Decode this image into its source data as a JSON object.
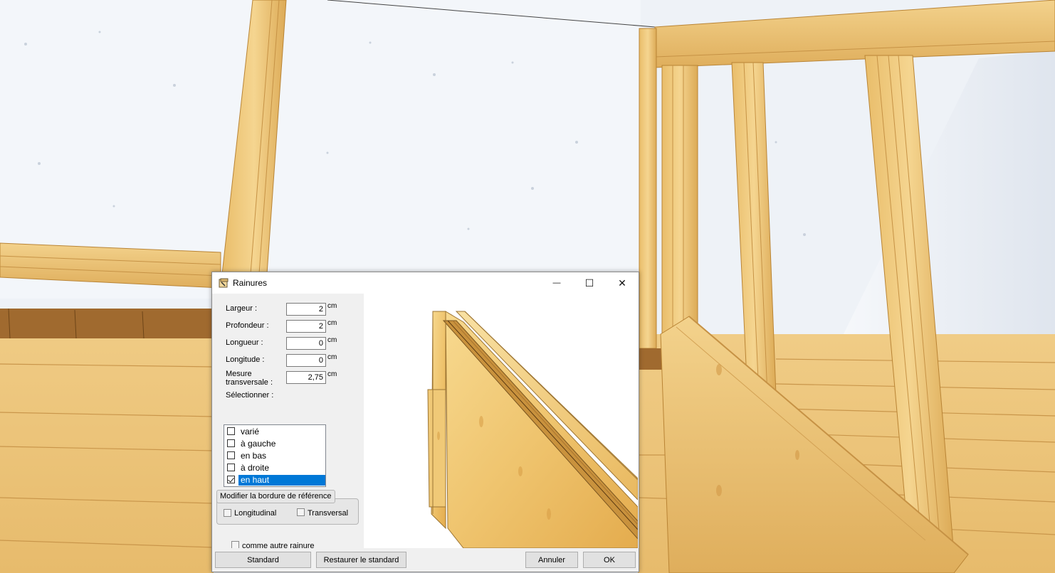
{
  "dialog": {
    "title": "Rainures",
    "window_controls": {
      "minimize": "—",
      "maximize": "☐",
      "close": "✕"
    }
  },
  "fields": [
    {
      "label": "Largeur :",
      "value": "2",
      "unit": "cm"
    },
    {
      "label": "Profondeur :",
      "value": "2",
      "unit": "cm"
    },
    {
      "label": "Longueur :",
      "value": "0",
      "unit": "cm"
    },
    {
      "label": "Longitude :",
      "value": "0",
      "unit": "cm"
    },
    {
      "label": "Mesure transversale :",
      "value": "2,75",
      "unit": "cm"
    }
  ],
  "select_label": "Sélectionner :",
  "select_items": [
    {
      "label": "varié",
      "checked": false,
      "selected": false
    },
    {
      "label": "à gauche",
      "checked": false,
      "selected": false
    },
    {
      "label": "en bas",
      "checked": false,
      "selected": false
    },
    {
      "label": "à droite",
      "checked": false,
      "selected": false
    },
    {
      "label": "en haut",
      "checked": true,
      "selected": true
    }
  ],
  "reference_group": {
    "caption": "Modifier la bordure de référence",
    "longitudinal": "Longitudinal",
    "transversal": "Transversal"
  },
  "same_as_other": "comme autre rainure",
  "buttons": {
    "standard": "Standard",
    "restore": "Restaurer le standard",
    "cancel": "Annuler",
    "ok": "OK"
  },
  "colors": {
    "wood_light": "#f2cf86",
    "wood_mid": "#e3b35e",
    "wood_dark": "#b98435",
    "sky": "#eef2f7",
    "selection": "#0078d7"
  }
}
